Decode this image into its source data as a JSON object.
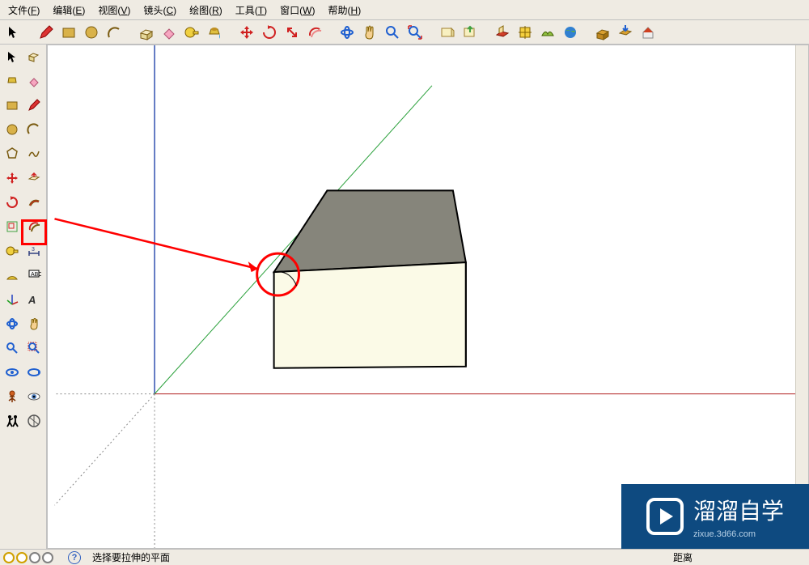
{
  "menu": {
    "file": {
      "label": "文件",
      "accel": "F"
    },
    "edit": {
      "label": "编辑",
      "accel": "E"
    },
    "view": {
      "label": "视图",
      "accel": "V"
    },
    "camera": {
      "label": "镜头",
      "accel": "C"
    },
    "draw": {
      "label": "绘图",
      "accel": "R"
    },
    "tools": {
      "label": "工具",
      "accel": "T"
    },
    "window": {
      "label": "窗口",
      "accel": "W"
    },
    "help": {
      "label": "帮助",
      "accel": "H"
    }
  },
  "status": {
    "hint": "选择要拉伸的平面",
    "right_label": "距离"
  },
  "watermark": {
    "title": "溜溜自学",
    "sub": "zixue.3d66.com"
  },
  "colors": {
    "accent": "#ff0000",
    "canvas_bg": "#ffffff",
    "ui_bg": "#efebe3",
    "box_top": "#86857b",
    "box_front": "#fbfae7",
    "axis_blue": "#304fb0",
    "axis_green": "#2aa03b",
    "axis_red": "#b02020"
  },
  "top_toolbar": [
    "select-arrow",
    "|",
    "pencil",
    "rectangle",
    "circle",
    "arc",
    "|",
    "push-pull",
    "eraser",
    "tape-measure",
    "paint-bucket",
    "|",
    "move-red",
    "rotate-red",
    "orbit-arrows",
    "swap-red",
    "|",
    "orbit",
    "pan-hand",
    "zoom",
    "zoom-extents",
    "|",
    "iso",
    "get-model",
    "|",
    "google-earth-1",
    "google-earth-2",
    "google-earth-3",
    "google-earth-4",
    "|",
    "warehouse-1",
    "warehouse-2",
    "warehouse-3"
  ],
  "left_toolbar_rows": [
    [
      "select-arrow",
      "make-component"
    ],
    [
      "paint-bucket",
      "eraser"
    ],
    [
      "rectangle",
      "line"
    ],
    [
      "circle",
      "arc"
    ],
    [
      "polygon",
      "freehand"
    ],
    [
      "move",
      "push-pull"
    ],
    [
      "rotate",
      "follow-me"
    ],
    [
      "scale",
      "offset"
    ],
    [
      "tape",
      "dimension"
    ],
    [
      "protractor",
      "text"
    ],
    [
      "axes",
      "3d-text"
    ],
    [
      "orbit",
      "pan"
    ],
    [
      "zoom",
      "zoom-window"
    ],
    [
      "prev-view",
      "next-view"
    ],
    [
      "position-camera",
      "look-around"
    ],
    [
      "walk",
      "section"
    ]
  ]
}
